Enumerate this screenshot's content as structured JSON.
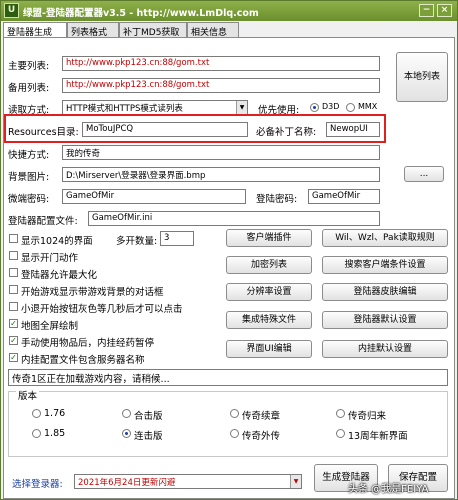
{
  "title": {
    "text": "绿盟-登陆器配置器v3.5 - http://www.LmDlq.com",
    "min": "−",
    "close": "×"
  },
  "tabs": [
    "登陆器生成",
    "列表格式",
    "补丁MD5获取",
    "相关信息"
  ],
  "main_list": {
    "label": "主要列表:",
    "value": "http://www.pkp123.cn:88/gom.txt"
  },
  "backup_list": {
    "label": "备用列表:",
    "value": "http://www.pkp123.cn:88/gom.txt"
  },
  "local_list_button": "本地列表",
  "read_mode": {
    "label": "读取方式:",
    "value": "HTTP模式和HTTPS模式读列表"
  },
  "priority": {
    "label": "优先使用:",
    "options": [
      "D3D",
      "MMX"
    ]
  },
  "resources": {
    "label": "Resources目录:",
    "value": "MoTouJPCQ"
  },
  "patch_name": {
    "label": "必备补丁名称:",
    "value": "NewopUI"
  },
  "shortcut": {
    "label": "快捷方式:",
    "value": "我的传奇"
  },
  "background": {
    "label": "背景图片:",
    "value": "D:\\Mirserver\\登录器\\登录界面.bmp",
    "browse": "..."
  },
  "micro_pwd": {
    "label": "微端密码:",
    "value": "GameOfMir"
  },
  "login_pwd": {
    "label": "登陆密码:",
    "value": "GameOfMir"
  },
  "config_file": {
    "label": "登陆器配置文件:",
    "value": "GameOfMir.ini"
  },
  "multi_count": {
    "label": "多开数量:",
    "value": "3"
  },
  "checkboxes": [
    {
      "label": "显示1024的界面",
      "checked": false
    },
    {
      "label": "显示开门动作",
      "checked": false
    },
    {
      "label": "登陆器允许最大化",
      "checked": false
    },
    {
      "label": "开始游戏显示带游戏背景的对话框",
      "checked": false
    },
    {
      "label": "小退开始按钮灰色等几秒后才可以点击",
      "checked": false
    },
    {
      "label": "地图全屏绘制",
      "checked": true
    },
    {
      "label": "手动使用物品后，内挂经药暂停",
      "checked": true
    },
    {
      "label": "内挂配置文件包含服务器名称",
      "checked": true
    }
  ],
  "buttons": [
    "客户端插件",
    "Wil、Wzl、Pak读取规则",
    "加密列表",
    "搜索客户端条件设置",
    "分辨率设置",
    "登陆器皮肤编辑",
    "集成特殊文件",
    "登陆器默认设置",
    "界面UI编辑",
    "内挂默认设置"
  ],
  "status_text": "传奇1区正在加载游戏内容，请稍候...",
  "version": {
    "label": "版本",
    "options": [
      {
        "label": "1.76",
        "on": false
      },
      {
        "label": "合击版",
        "on": false
      },
      {
        "label": "传奇续章",
        "on": false
      },
      {
        "label": "传奇归来",
        "on": false
      },
      {
        "label": "1.85",
        "on": false
      },
      {
        "label": "连击版",
        "on": true
      },
      {
        "label": "传奇外传",
        "on": false
      },
      {
        "label": "13周年新界面",
        "on": false
      }
    ]
  },
  "select_login": {
    "label": "选择登录器:",
    "value": "2021年6月24日更新闪避"
  },
  "generate_button": "生成登陆器",
  "save_button": "保存配置",
  "watermark": "头条 @我是FEIYA",
  "colors": {
    "title_bar": "#7a9d38",
    "red_value": "#c00000",
    "highlight": "#e02020"
  }
}
